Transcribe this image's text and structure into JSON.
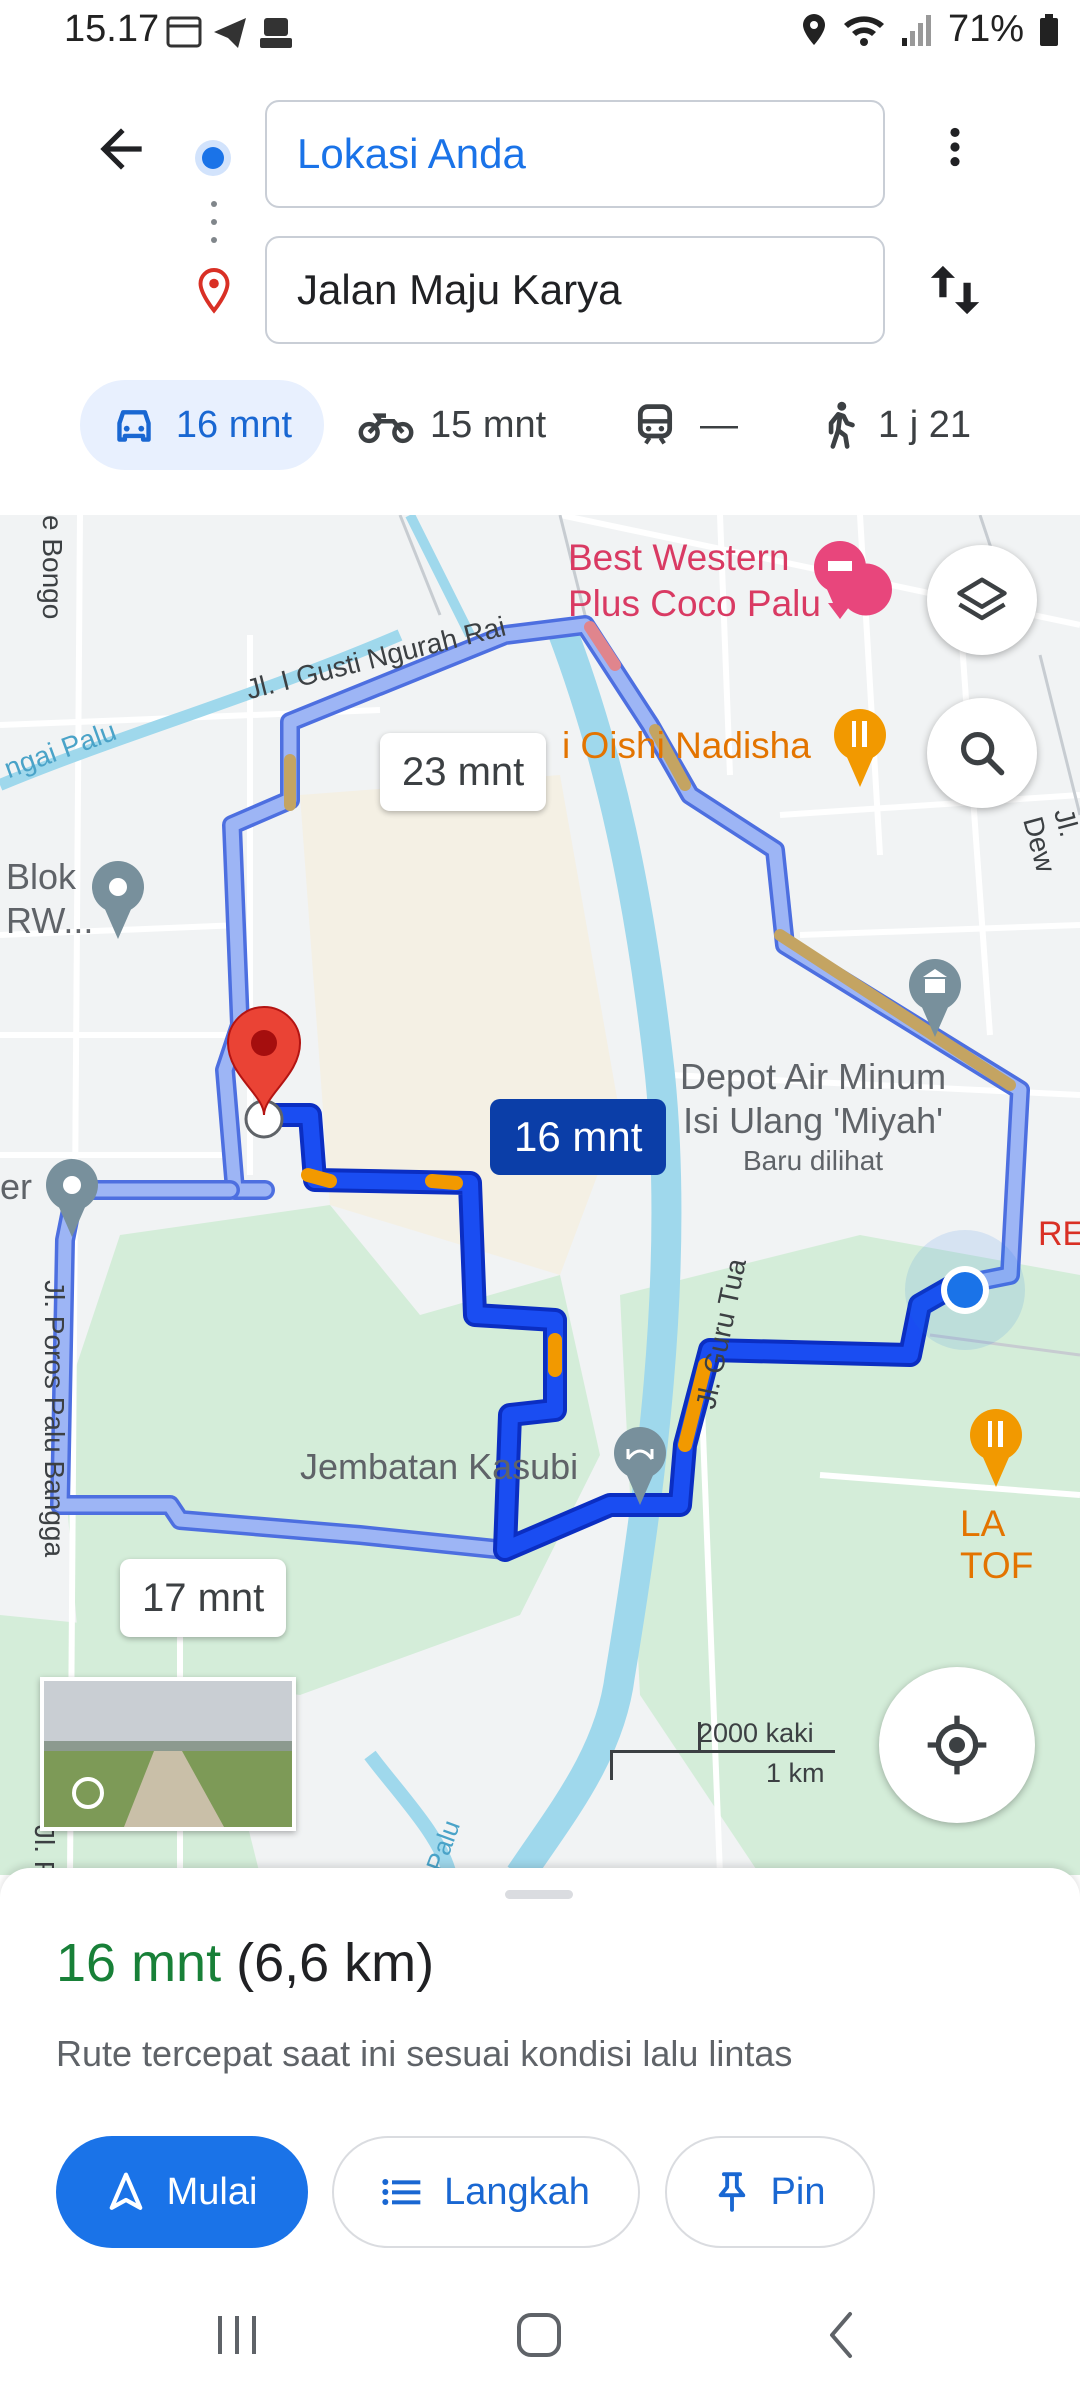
{
  "status_bar": {
    "time": "15.17",
    "battery": "71%"
  },
  "header": {
    "origin": "Lokasi Anda",
    "destination": "Jalan Maju Karya"
  },
  "modes": [
    {
      "name": "car",
      "label": "16 mnt",
      "selected": true
    },
    {
      "name": "motorbike",
      "label": "15 mnt"
    },
    {
      "name": "transit",
      "label": "—"
    },
    {
      "name": "walk",
      "label": "1 j 21"
    }
  ],
  "map": {
    "route_chips": {
      "alt_top": "23 mnt",
      "selected": "16 mnt",
      "alt_bottom": "17 mnt"
    },
    "poi": {
      "hotel_line1": "Best Western",
      "hotel_line2": "Plus Coco Palu",
      "restaurant1": "i Oishi Nadisha",
      "blok_line1": "Blok",
      "blok_line2": "RW...",
      "depot_line1": "Depot Air Minum",
      "depot_line2": "Isi Ulang 'Miyah'",
      "depot_note": "Baru dilihat",
      "bridge": "Jembatan Kasubi",
      "restaurant2": "LA TOF",
      "left_edge": "er",
      "right_edge": "RE"
    },
    "roads": {
      "bongo": "e Bongo",
      "gusti": "Jl. I Gusti Ngurah Rai",
      "sungai": "ngai Palu",
      "dewi": "Jl. Dew",
      "poros": "Jl. Poros Palu Bangga",
      "guru": "Jl. Guru Tua",
      "palu_bottom": "Palu",
      "jlp": "Jl. P"
    },
    "scale": {
      "imperial": "2000 kaki",
      "metric": "1 km"
    }
  },
  "sheet": {
    "time": "16 mnt",
    "distance": "(6,6 km)",
    "subtitle": "Rute tercepat saat ini sesuai kondisi lalu lintas",
    "start_label": "Mulai",
    "steps_label": "Langkah",
    "pin_label": "Pin"
  },
  "colors": {
    "route_selected": "#1a4df2",
    "route_alt": "#7c9cf0",
    "traffic_slow": "#f29900",
    "accent": "#1a73e8",
    "green": "#188038",
    "water": "#9fd8ec",
    "park": "#d2ecd6"
  }
}
